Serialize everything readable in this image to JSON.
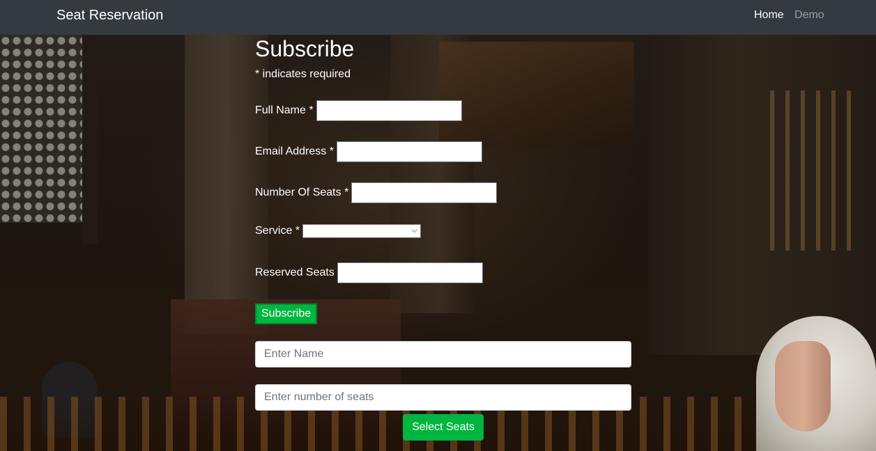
{
  "navbar": {
    "brand": "Seat Reservation",
    "links": [
      {
        "label": "Home",
        "active": true
      },
      {
        "label": "Demo",
        "active": false
      }
    ]
  },
  "form": {
    "title": "Subscribe",
    "required_note": "* indicates required",
    "fields": {
      "full_name": {
        "label": "Full Name",
        "marker": "*",
        "value": ""
      },
      "email": {
        "label": "Email Address",
        "marker": "*",
        "value": ""
      },
      "seats": {
        "label": "Number Of Seats",
        "marker": "*",
        "value": ""
      },
      "service": {
        "label": "Service",
        "marker": "*",
        "selected": ""
      },
      "reserved": {
        "label": "Reserved Seats",
        "value": ""
      }
    },
    "subscribe_label": "Subscribe"
  },
  "seat_picker": {
    "name_placeholder": "Enter Name",
    "seats_placeholder": "Enter number of seats",
    "select_label": "Select Seats"
  },
  "colors": {
    "navbar_bg": "#343a40",
    "accent_green": "#00b640"
  }
}
